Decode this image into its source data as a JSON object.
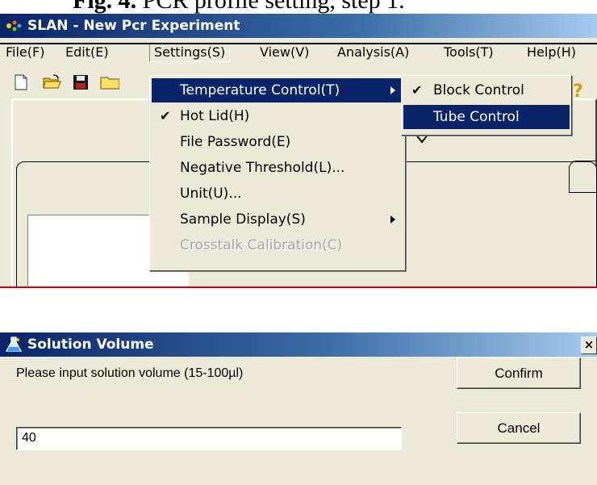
{
  "caption": {
    "label": "Fig. 4.",
    "text": "PCR profile setting, step 1."
  },
  "app": {
    "title": "SLAN - New Pcr Experiment",
    "menubar": [
      "File(F)",
      "Edit(E)",
      "Settings(S)",
      "View(V)",
      "Analysis(A)",
      "Tools(T)",
      "Help(H)"
    ]
  },
  "settings_menu": {
    "items": [
      {
        "label": "Temperature Control(T)",
        "checked": false,
        "submenu": true,
        "highlighted": true
      },
      {
        "label": "Hot Lid(H)",
        "checked": true
      },
      {
        "label": "File Password(E)"
      },
      {
        "label": "Negative Threshold(L)..."
      },
      {
        "label": "Unit(U)..."
      },
      {
        "label": "Sample Display(S)",
        "submenu": true
      },
      {
        "label": "Crosstalk Calibration(C)",
        "disabled": true
      }
    ]
  },
  "temperature_submenu": {
    "items": [
      {
        "label": "Block Control",
        "checked": true
      },
      {
        "label": "Tube Control",
        "highlighted": true
      }
    ]
  },
  "dialog": {
    "title": "Solution Volume",
    "prompt": "Please input solution volume (15-100µl)",
    "value": "40",
    "confirm_label": "Confirm",
    "cancel_label": "Cancel",
    "close_label": "×"
  },
  "colors": {
    "titlebar": "#0a246a",
    "menu_highlight": "#0a246a",
    "separator_red": "#d00000",
    "window_bg": "#ece9d8"
  }
}
